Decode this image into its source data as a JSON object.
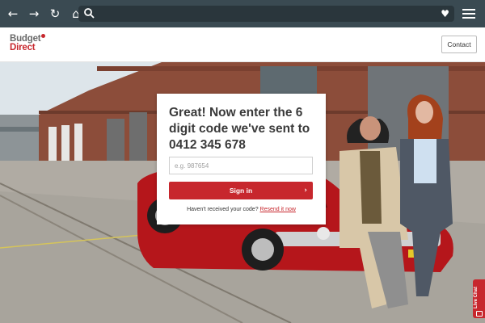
{
  "browser": {
    "nav_icons": [
      "back-icon",
      "forward-icon",
      "reload-icon",
      "home-icon"
    ],
    "url_value": "",
    "bookmark_icon": "heart-icon",
    "menu_icon": "hamburger-icon"
  },
  "header": {
    "logo_line1": "Budget",
    "logo_line2": "Direct",
    "contact_label": "Contact"
  },
  "modal": {
    "heading": "Great! Now enter the 6 digit code we've sent to 0412 345 678",
    "code_value": "",
    "code_placeholder": "e.g. 987654",
    "signin_label": "Sign in",
    "resend_prefix": "Haven't received your code?",
    "resend_link": "Resend it now"
  },
  "livechat": {
    "label": "Live Chat"
  },
  "car": {
    "plate": ""
  },
  "colors": {
    "brand_red": "#c7272d",
    "chrome_bg": "#3a4a52",
    "text_dark": "#3a3a3a"
  }
}
